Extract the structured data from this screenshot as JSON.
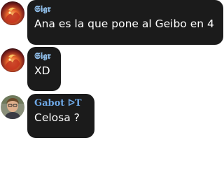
{
  "colors": {
    "bubble_bg": "#1b1b1b",
    "message_text": "#ffffff"
  },
  "messages": [
    {
      "author": "𝕾𝖎𝖌𝖗",
      "author_color": "#8fbde8",
      "text": "Ana es la que pone al Geibo en 4",
      "avatar": "fiery-creature-avatar"
    },
    {
      "author": "𝕾𝖎𝖌𝖗",
      "author_color": "#8fbde8",
      "text": "XD",
      "avatar": "fiery-creature-avatar"
    },
    {
      "author": "Gabot ᐅT",
      "author_color": "#6ea8e6",
      "text": "Celosa ?",
      "avatar": "person-photo-avatar"
    }
  ]
}
